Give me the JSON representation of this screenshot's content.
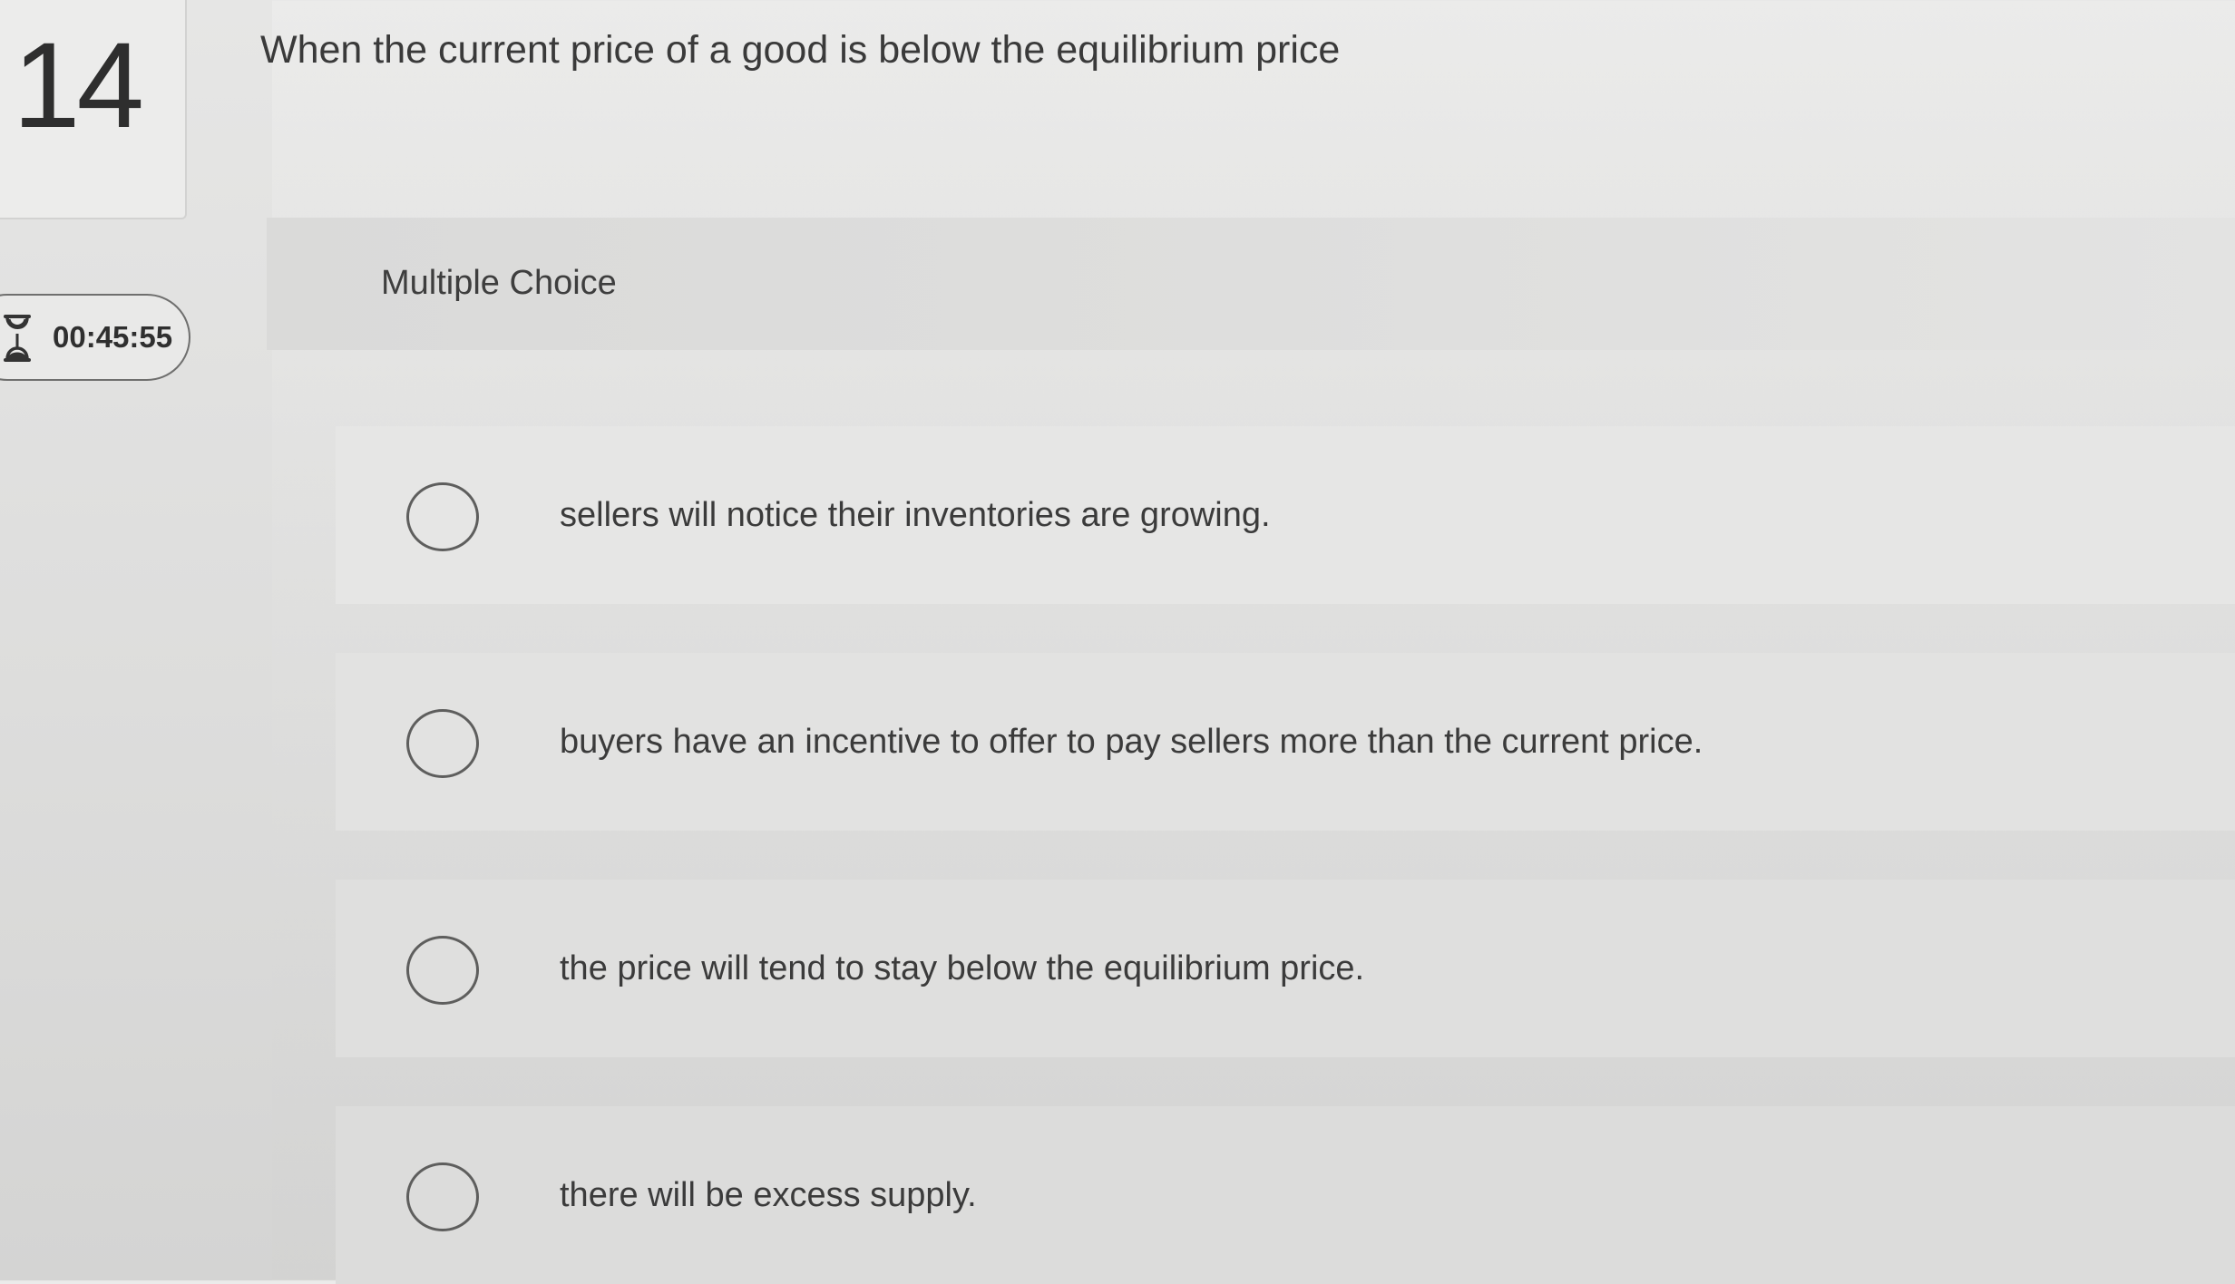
{
  "question": {
    "number": "14",
    "text": "When the current price of a good is below the equilibrium price"
  },
  "timer": {
    "icon": "hourglass-icon",
    "value": "00:45:55"
  },
  "question_type": {
    "label": "Multiple Choice"
  },
  "options": [
    {
      "text": "sellers will notice their inventories are growing.",
      "selected": false
    },
    {
      "text": "buyers have an incentive to offer to pay sellers more than the current price.",
      "selected": false
    },
    {
      "text": "the price will tend to stay below the equilibrium price.",
      "selected": false
    },
    {
      "text": "there will be excess supply.",
      "selected": false
    }
  ]
}
